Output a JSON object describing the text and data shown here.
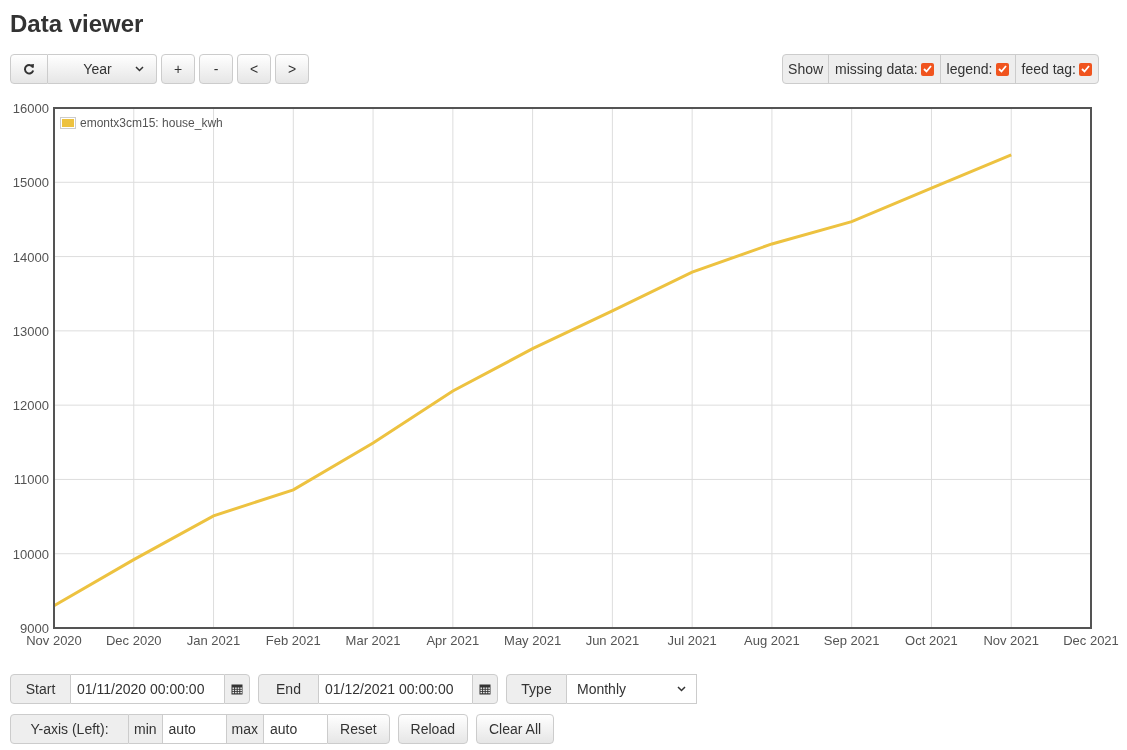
{
  "title": "Data viewer",
  "toolbar": {
    "period": "Year",
    "buttons": [
      "+",
      "-",
      "<",
      ">"
    ]
  },
  "show": {
    "label": "Show",
    "options": [
      {
        "label": "missing data:",
        "checked": true
      },
      {
        "label": "legend:",
        "checked": true
      },
      {
        "label": "feed tag:",
        "checked": true
      }
    ]
  },
  "chart": {
    "chart_data": {
      "type": "line",
      "categories": [
        "Nov 2020",
        "Dec 2020",
        "Jan 2021",
        "Feb 2021",
        "Mar 2021",
        "Apr 2021",
        "May 2021",
        "Jun 2021",
        "Jul 2021",
        "Aug 2021",
        "Sep 2021",
        "Oct 2021",
        "Nov 2021",
        "Dec 2021"
      ],
      "series": [
        {
          "name": "emontx3cm15: house_kwh",
          "color": "#edc240",
          "values": [
            9300,
            9920,
            10510,
            10860,
            11490,
            12190,
            12760,
            13270,
            13790,
            14170,
            14470,
            14920,
            15370,
            null
          ]
        }
      ],
      "ylim": [
        9000,
        16000
      ],
      "grid": true,
      "yticks": [
        9000,
        10000,
        11000,
        12000,
        13000,
        14000,
        15000,
        16000
      ]
    }
  },
  "range": {
    "start_label": "Start",
    "start": "01/11/2020 00:00:00",
    "end_label": "End",
    "end": "01/12/2021 00:00:00",
    "type_label": "Type",
    "type": "Monthly"
  },
  "yaxis": {
    "label": "Y-axis (Left):",
    "min_label": "min",
    "min": "auto",
    "max_label": "max",
    "max": "auto",
    "buttons": [
      "Reset",
      "Reload",
      "Clear All"
    ]
  }
}
